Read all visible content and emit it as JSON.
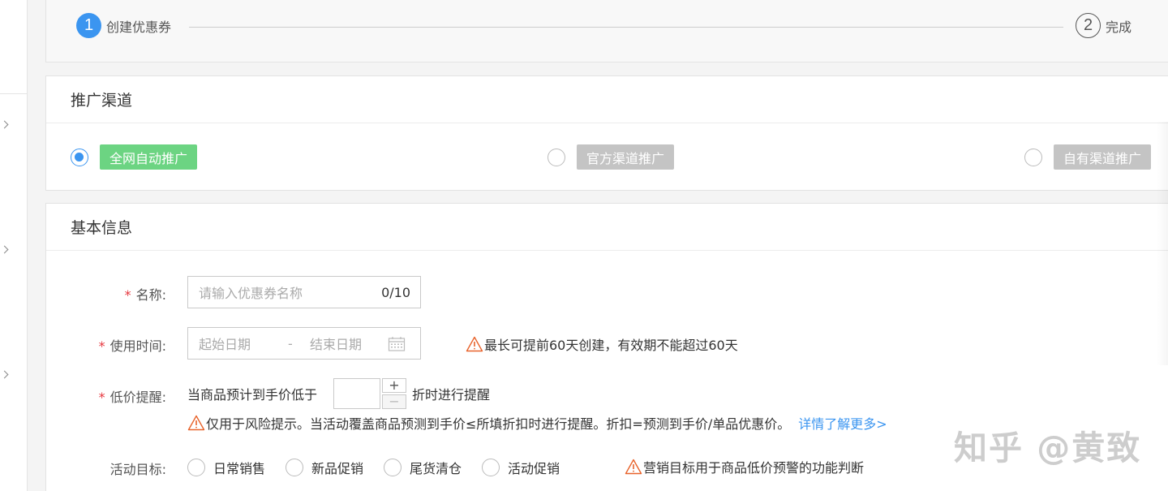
{
  "steps": [
    {
      "num": "1",
      "label": "创建优惠券"
    },
    {
      "num": "2",
      "label": "完成"
    }
  ],
  "channel": {
    "title": "推广渠道",
    "options": [
      {
        "label": "全网自动推广",
        "selected": true
      },
      {
        "label": "官方渠道推广",
        "selected": false
      },
      {
        "label": "自有渠道推广",
        "selected": false
      }
    ]
  },
  "basic": {
    "title": "基本信息",
    "name": {
      "required_mark": "*",
      "label": "名称:",
      "placeholder": "请输入优惠券名称",
      "counter": "0/10"
    },
    "time": {
      "required_mark": "*",
      "label": "使用时间:",
      "start_placeholder": "起始日期",
      "separator": "-",
      "end_placeholder": "结束日期",
      "warning": "最长可提前60天创建，有效期不能超过60天"
    },
    "price_alert": {
      "required_mark": "*",
      "label": "低价提醒:",
      "prefix": "当商品预计到手价低于",
      "suffix": "折时进行提醒",
      "plus": "+",
      "minus": "−",
      "warning": "仅用于风险提示。当活动覆盖商品预测到手价≤所填折扣时进行提醒。折扣=预测到手价/单品优惠价。",
      "link": "详情了解更多>"
    },
    "goal": {
      "label": "活动目标:",
      "options": [
        "日常销售",
        "新品促销",
        "尾货清仓",
        "活动促销"
      ],
      "warning": "营销目标用于商品低价预警的功能判断"
    }
  },
  "watermark": "知乎 @黄致",
  "colors": {
    "primary": "#3b95f0",
    "green_tag": "#6cd482",
    "gray_tag": "#c4c4c4",
    "required": "#e6353d",
    "warning": "#e8632b"
  }
}
